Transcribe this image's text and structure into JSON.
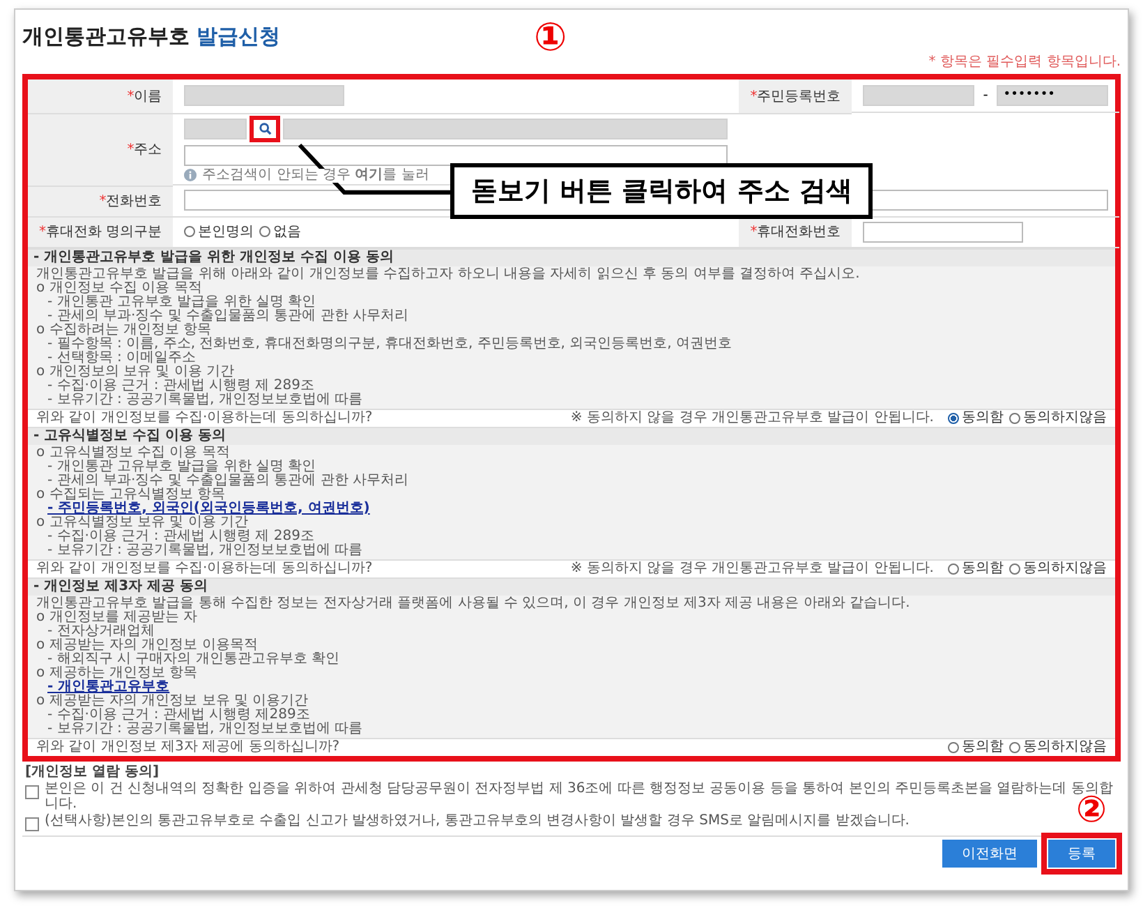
{
  "page_title": {
    "main": "개인통관고유부호",
    "accent": "발급신청"
  },
  "annotation_numbers": [
    "①",
    "②"
  ],
  "required_note": "* 항목은 필수입력 항목입니다.",
  "form": {
    "name": {
      "mark": "*",
      "label": "이름"
    },
    "resident_number": {
      "mark": "*",
      "label": "주민등록번호",
      "separator": "-",
      "masked_value": "•••••••"
    },
    "address": {
      "mark": "*",
      "label": "주소",
      "note": "주소검색이 안되는 경우 **여기**를 눌러"
    },
    "phone": {
      "mark": "*",
      "label": "전화번호"
    },
    "mobile_owner": {
      "mark": "*",
      "label": "휴대전화 명의구분",
      "options": [
        {
          "label": "본인명의",
          "selected": false
        },
        {
          "label": "없음",
          "selected": false
        }
      ]
    },
    "mobile_number": {
      "mark": "*",
      "label": "휴대전화번호"
    }
  },
  "callout": "돋보기 버튼 클릭하여 주소 검색",
  "consents": [
    {
      "title": "- 개인통관고유부호 발급을 위한 개인정보 수집 이용 동의",
      "intro": "개인통관고유부호 발급을 위해 아래와 같이 개인정보를 수집하고자 하오니 내용을 자세히 읽으신 후 동의 여부를 결정하여 주십시오.",
      "groups": [
        {
          "heading": "o 개인정보 수집 이용 목적",
          "lines": [
            {
              "text": "- 개인통관 고유부호 발급을 위한 실명 확인",
              "kind": "plain"
            },
            {
              "text": "- 관세의 부과·징수 및 수출입물품의 통관에 관한 사무처리",
              "kind": "plain"
            }
          ]
        },
        {
          "heading": "o 수집하려는 개인정보 항목",
          "lines": [
            {
              "text": "- 필수항목 : 이름, 주소, 전화번호, 휴대전화명의구분, 휴대전화번호, 주민등록번호, 외국인등록번호, 여권번호",
              "kind": "plain"
            },
            {
              "text": "- 선택항목 : 이메일주소",
              "kind": "plain"
            }
          ]
        },
        {
          "heading": "o 개인정보의 보유 및 이용 기간",
          "lines": [
            {
              "text": "- 수집·이용 근거 : 관세법 시행령 제 289조",
              "kind": "plain"
            },
            {
              "text": "- 보유기간 : 공공기록물법, 개인정보보호법에 따름",
              "kind": "plain"
            }
          ]
        }
      ],
      "question": "위와 같이 개인정보를 수집·이용하는데 동의하십니까?",
      "options": [
        {
          "label": "동의함",
          "selected": true
        },
        {
          "label": "동의하지않음",
          "selected": false
        }
      ],
      "warning": "※ 동의하지 않을 경우 개인통관고유부호 발급이 안됩니다."
    },
    {
      "title": "- 고유식별정보 수집 이용 동의",
      "groups": [
        {
          "heading": "o 고유식별정보 수집 이용 목적",
          "lines": [
            {
              "text": "- 개인통관 고유부호 발급을 위한 실명 확인",
              "kind": "plain"
            },
            {
              "text": "- 관세의 부과·징수 및 수출입물품의 통관에 관한 사무처리",
              "kind": "plain"
            }
          ]
        },
        {
          "heading": "o 수집되는 고유식별정보 항목",
          "lines": [
            {
              "text": "- 주민등록번호, 외국인(외국인등록번호, 여권번호)",
              "kind": "link"
            }
          ]
        },
        {
          "heading": "o 고유식별정보 보유 및 이용 기간",
          "lines": [
            {
              "text": "- 수집·이용 근거 : 관세법 시행령 제 289조",
              "kind": "plain"
            },
            {
              "text": "- 보유기간 : 공공기록물법, 개인정보보호법에 따름",
              "kind": "plain"
            }
          ]
        }
      ],
      "question": "위와 같이 개인정보를 수집·이용하는데 동의하십니까?",
      "options": [
        {
          "label": "동의함",
          "selected": false
        },
        {
          "label": "동의하지않음",
          "selected": false
        }
      ],
      "warning": "※ 동의하지 않을 경우 개인통관고유부호 발급이 안됩니다."
    },
    {
      "title": "- 개인정보 제3자 제공 동의",
      "intro": "개인통관고유부호 발급을 통해 수집한 정보는 전자상거래 플랫폼에 사용될 수 있으며, 이 경우 개인정보 제3자 제공 내용은 아래와 같습니다.",
      "groups": [
        {
          "heading": "o 개인정보를 제공받는 자",
          "lines": [
            {
              "text": "- 전자상거래업체",
              "kind": "plain"
            }
          ]
        },
        {
          "heading": "o 제공받는 자의 개인정보 이용목적",
          "lines": [
            {
              "text": "- 해외직구 시 구매자의 개인통관고유부호 확인",
              "kind": "plain"
            }
          ]
        },
        {
          "heading": "o 제공하는 개인정보 항목",
          "lines": [
            {
              "text": "- 개인통관고유부호",
              "kind": "link"
            }
          ]
        },
        {
          "heading": "o 제공받는 자의 개인정보 보유 및 이용기간",
          "lines": [
            {
              "text": "- 수집·이용 근거 : 관세법 시행령 제289조",
              "kind": "plain"
            },
            {
              "text": "- 보유기간 : 공공기록물법, 개인정보보호법에 따름",
              "kind": "plain"
            }
          ]
        }
      ],
      "question": "위와 같이 개인정보 제3자 제공에 동의하십니까?",
      "options": [
        {
          "label": "동의함",
          "selected": false
        },
        {
          "label": "동의하지않음",
          "selected": false
        }
      ]
    }
  ],
  "view_consent": {
    "title": "[개인정보 열람 동의]",
    "items": [
      {
        "text": "본인은 이 건 신청내역의 정확한 입증을 위하여 관세청 담당공무원이 전자정부법 제 36조에 따른 행정정보 공동이용 등을 통하여 본인의 주민등록초본을 열람하는데 동의합니다.",
        "checked": false
      },
      {
        "text": "(선택사항)본인의 통관고유부호로 수출입 신고가 발생하였거나, 통관고유부호의 변경사항이 발생할 경우 SMS로 알림메시지를 받겠습니다.",
        "checked": false
      }
    ]
  },
  "buttons": [
    {
      "label": "이전화면"
    },
    {
      "label": "등록"
    }
  ]
}
